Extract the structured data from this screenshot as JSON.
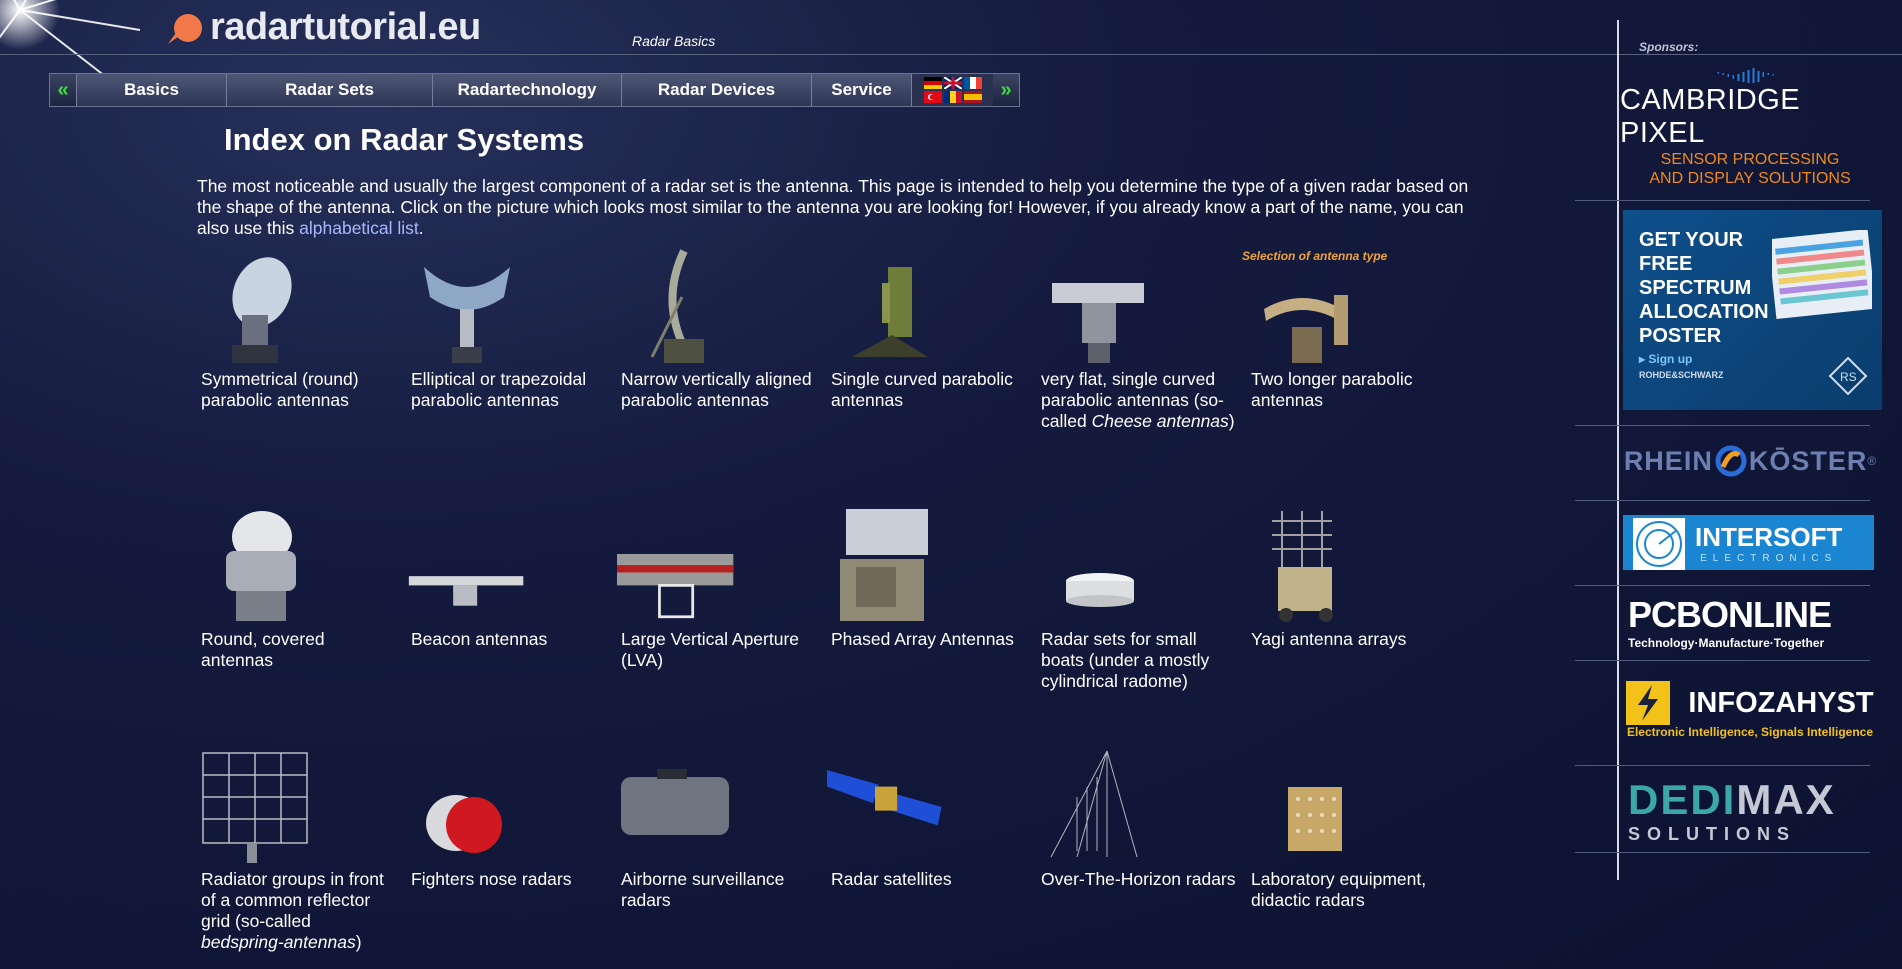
{
  "site": {
    "name": "radartutorial.eu",
    "section": "Radar Basics"
  },
  "nav": {
    "prev_label": "«",
    "next_label": "»",
    "items": [
      "Basics",
      "Radar Sets",
      "Radartechnology",
      "Radar Devices",
      "Service"
    ]
  },
  "page": {
    "title": "Index on Radar Systems",
    "intro": "The most noticeable and usually the largest component of a radar set is the antenna. This page is intended to help you determine the type of a given radar based on the shape of the antenna. Click on the picture which looks most similar to the antenna you are looking for! However, if you already know a part of the name, you can also use this ",
    "intro_link": "alphabetical list",
    "intro_end": ".",
    "selection_label": "Selection of antenna type"
  },
  "antennas": [
    {
      "a": "Symmetrical (round) parabolic antennas"
    },
    {
      "a": "Elliptical or trapezoidal parabolic antennas"
    },
    {
      "a": "Narrow vertically aligned parabolic antennas"
    },
    {
      "a": "Single curved parabolic antennas"
    },
    {
      "a": "very flat, single curved parabolic antennas (so-called ",
      "i": "Cheese antennas",
      "b": ")"
    },
    {
      "a": "Two longer parabolic antennas"
    },
    {
      "a": "Round, covered antennas"
    },
    {
      "a": "Beacon antennas"
    },
    {
      "a": "Large Vertical Aperture (LVA)"
    },
    {
      "a": "Phased Array Antennas"
    },
    {
      "a": "Radar sets for small boats (under a mostly cylindrical radome)"
    },
    {
      "a": "Yagi antenna arrays"
    },
    {
      "a": "Radiator groups in front of a common reflector grid (so-called ",
      "i": "bedspring-antennas",
      "b": ")"
    },
    {
      "a": "Fighters nose radars"
    },
    {
      "a": "Airborne surveillance radars"
    },
    {
      "a": "Radar satellites"
    },
    {
      "a": "Over-The-Horizon radars"
    },
    {
      "a": "Laboratory equipment, didactic radars"
    }
  ],
  "sponsors": {
    "label": "Sponsors:",
    "cambridge_pixel": {
      "name": "CAMBRIDGE PIXEL",
      "tagline_1": "SENSOR PROCESSING",
      "tagline_2": "AND DISPLAY SOLUTIONS"
    },
    "rohde_schwarz": {
      "title": "GET YOUR FREE SPECTRUM ALLOCATION POSTER",
      "cta": "▸ Sign up",
      "brand": "ROHDE&SCHWARZ"
    },
    "rhein_koster": {
      "name_1": "RHEIN",
      "name_2": "KŌSTER",
      "mark": "®"
    },
    "intersoft": {
      "name": "INTERSOFT",
      "sub": "ELECTRONICS"
    },
    "pcbonline": {
      "name": "PCBONLINE",
      "tagline": "Technology·Manufacture·Together"
    },
    "infozahyst": {
      "name": "INFOZAHYST",
      "tagline": "Electronic Intelligence, Signals Intelligence"
    },
    "dedimax": {
      "name_1": "DEDI",
      "name_2": "MAX",
      "sub": "SOLUTIONS"
    }
  },
  "colors": {
    "accent_orange": "#f08a1c",
    "link": "#a8b8ff",
    "nav_arrow": "#39e03a"
  }
}
